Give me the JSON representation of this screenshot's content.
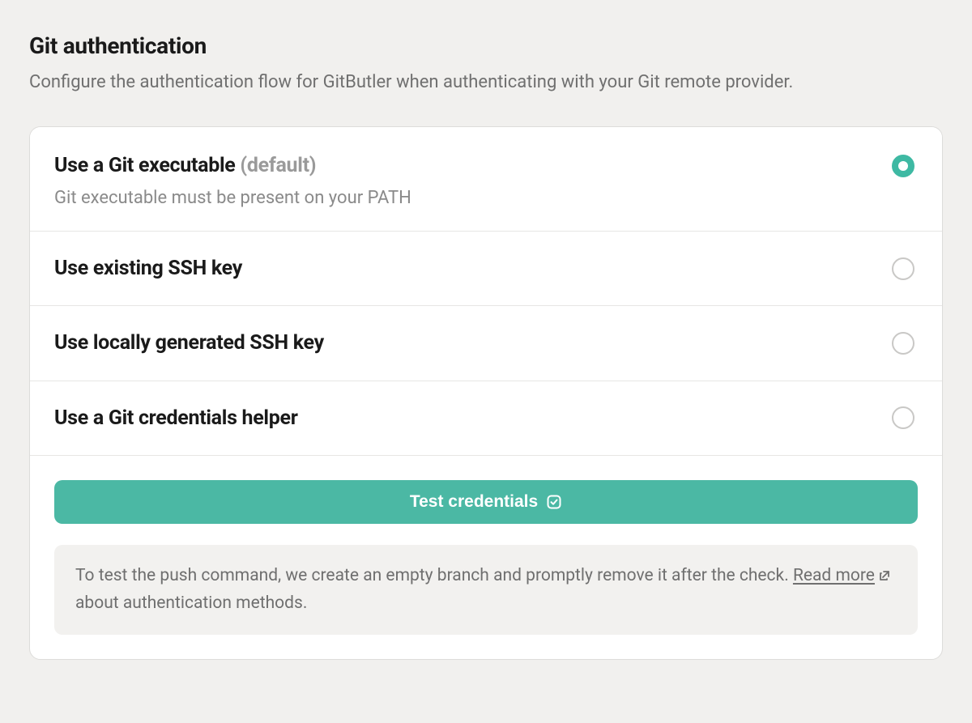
{
  "section": {
    "title": "Git authentication",
    "subtitle": "Configure the authentication flow for GitButler when authenticating with your Git remote provider."
  },
  "options": [
    {
      "label": "Use a Git executable",
      "default_tag": "(default)",
      "desc": "Git executable must be present on your PATH",
      "selected": true,
      "name": "git-executable"
    },
    {
      "label": "Use existing SSH key",
      "default_tag": "",
      "desc": "",
      "selected": false,
      "name": "existing-ssh-key"
    },
    {
      "label": "Use locally generated SSH key",
      "default_tag": "",
      "desc": "",
      "selected": false,
      "name": "locally-generated-ssh-key"
    },
    {
      "label": "Use a Git credentials helper",
      "default_tag": "",
      "desc": "",
      "selected": false,
      "name": "git-credentials-helper"
    }
  ],
  "test_button_label": "Test credentials",
  "info": {
    "prefix": "To test the push command, we create an empty branch and promptly remove it after the check. ",
    "link_label": "Read more",
    "suffix": " about authentication methods."
  },
  "colors": {
    "accent": "#3eb9a3",
    "button": "#4bb8a4",
    "bg": "#f1f0ee"
  }
}
